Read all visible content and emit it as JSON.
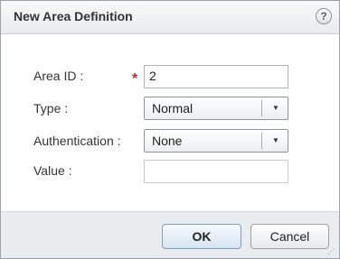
{
  "dialog": {
    "title": "New Area Definition",
    "help_glyph": "?"
  },
  "form": {
    "area_id": {
      "label": "Area ID :",
      "required_marker": "*",
      "value": "2"
    },
    "type": {
      "label": "Type :",
      "selected": "Normal"
    },
    "authentication": {
      "label": "Authentication :",
      "selected": "None"
    },
    "value": {
      "label": "Value :",
      "value": ""
    }
  },
  "buttons": {
    "ok": "OK",
    "cancel": "Cancel"
  },
  "icons": {
    "help": "help-icon",
    "dropdown": "chevron-down-icon",
    "resize": "resize-grip-icon"
  },
  "colors": {
    "required": "#cc2a1f",
    "footer_bg": "#eaedf0",
    "ok_border": "#7c9fbf"
  }
}
